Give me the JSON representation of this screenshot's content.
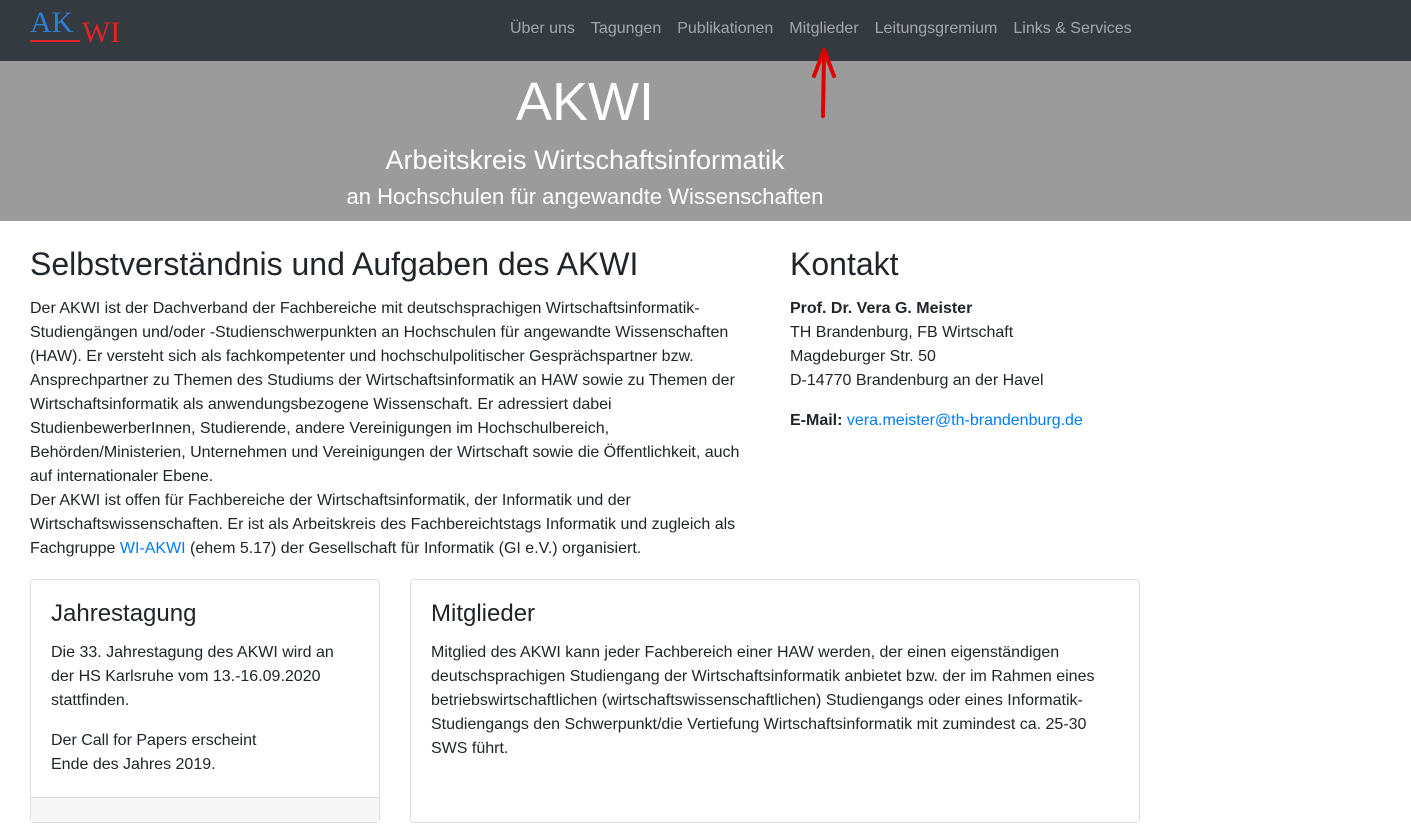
{
  "logo": {
    "part1": "AK",
    "part2": "WI"
  },
  "nav": {
    "items": [
      {
        "label": "Über uns"
      },
      {
        "label": "Tagungen"
      },
      {
        "label": "Publikationen"
      },
      {
        "label": "Mitglieder"
      },
      {
        "label": "Leitungsgremium"
      },
      {
        "label": "Links & Services"
      }
    ]
  },
  "hero": {
    "title": "AKWI",
    "subtitle": "Arbeitskreis Wirtschaftsinformatik",
    "subtitle2": "an Hochschulen für angewandte Wissenschaften"
  },
  "about": {
    "heading": "Selbstverständnis und Aufgaben des AKWI",
    "para1": "Der AKWI ist der Dachverband der Fachbereiche mit deutschsprachigen Wirtschaftsinformatik-Studiengängen und/oder -Studienschwerpunkten an Hochschulen für angewandte Wissenschaften (HAW). Er versteht sich als fachkompetenter und hochschulpolitischer Gesprächspartner bzw. Ansprechpartner zu Themen des Studiums der Wirtschaftsinformatik an HAW sowie zu Themen der Wirtschaftsinformatik als anwendungsbezogene Wissenschaft. Er adressiert dabei StudienbewerberInnen, Studierende, andere Vereinigungen im Hochschulbereich, Behörden/Ministerien, Unternehmen und Vereinigungen der Wirtschaft sowie die Öffentlichkeit, auch auf internationaler Ebene.",
    "para2_before": "Der AKWI ist offen für Fachbereiche der Wirtschaftsinformatik, der Informatik und der Wirtschaftswissenschaften. Er ist als Arbeitskreis des Fachbereichtstags Informatik und zugleich als Fachgruppe ",
    "para2_link": "WI-AKWI",
    "para2_after": " (ehem 5.17) der Gesellschaft für Informatik (GI e.V.) organisiert."
  },
  "contact": {
    "heading": "Kontakt",
    "name": "Prof. Dr. Vera G. Meister",
    "line1": "TH Brandenburg, FB Wirtschaft",
    "line2": "Magdeburger Str. 50",
    "line3": "D-14770 Brandenburg an der Havel",
    "email_label": "E-Mail:",
    "email": "vera.meister@th-brandenburg.de"
  },
  "cards": {
    "jahrestagung": {
      "title": "Jahrestagung",
      "text1": "Die 33. Jahrestagung des AKWI wird an der HS Karlsruhe vom 13.-16.09.2020 stattfinden.",
      "text2a": "Der Call for Papers erscheint",
      "text2b": "Ende des Jahres 2019."
    },
    "mitglieder": {
      "title": "Mitglieder",
      "text": "Mitglied des AKWI kann jeder Fachbereich einer HAW werden, der einen eigenständigen deutschsprachigen Studiengang der Wirtschaftsinformatik anbietet bzw. der im Rahmen eines betriebswirtschaftlichen (wirtschaftswissenschaftlichen) Studiengangs oder eines Informatik-Studiengangs den Schwerpunkt/die Vertiefung Wirtschaftsinformatik mit zumindest ca. 25-30 SWS führt."
    }
  },
  "annotation": {
    "arrow_color": "#e00000"
  }
}
